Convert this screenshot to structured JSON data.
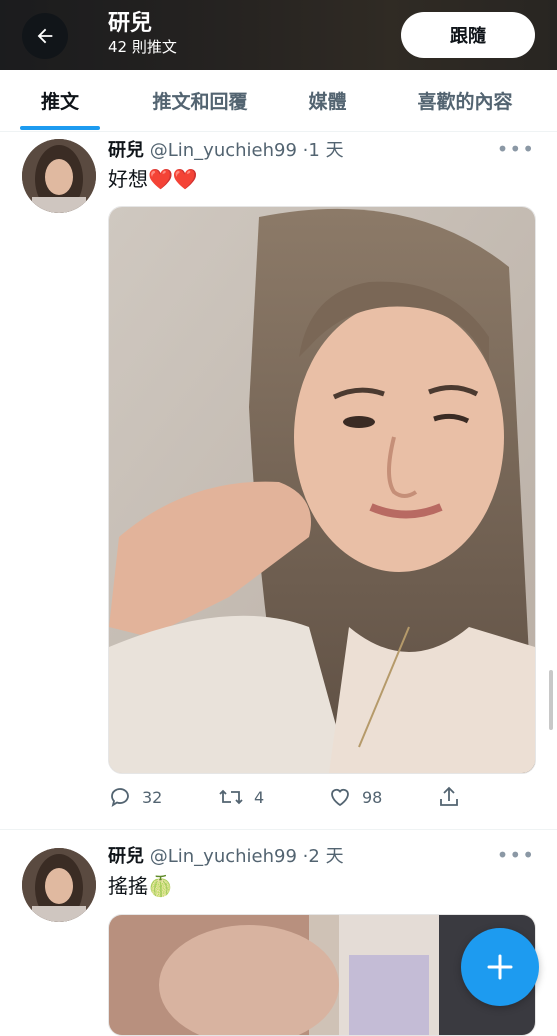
{
  "header": {
    "name": "研兒",
    "post_count": "42 則推文",
    "follow_label": "跟隨"
  },
  "tabs": [
    {
      "label": "推文",
      "active": true
    },
    {
      "label": "推文和回覆",
      "active": false
    },
    {
      "label": "媒體",
      "active": false
    },
    {
      "label": "喜歡的內容",
      "active": false
    }
  ],
  "tweets": [
    {
      "name": "研兒",
      "handle": "@Lin_yuchieh99",
      "time": "·1 天",
      "text": "好想",
      "emoji": "❤️❤️",
      "replies": "32",
      "retweets": "4",
      "likes": "98"
    },
    {
      "name": "研兒",
      "handle": "@Lin_yuchieh99",
      "time": "·2 天",
      "text": "搖搖",
      "emoji": "🍈"
    }
  ],
  "icons": {
    "back": "arrow-left-icon",
    "more": "more-icon",
    "reply": "reply-icon",
    "retweet": "retweet-icon",
    "like": "heart-icon",
    "share": "share-icon",
    "compose": "plus-icon"
  },
  "colors": {
    "accent": "#1d9bf0",
    "muted_text": "#536471",
    "heart": "#e0245e"
  }
}
